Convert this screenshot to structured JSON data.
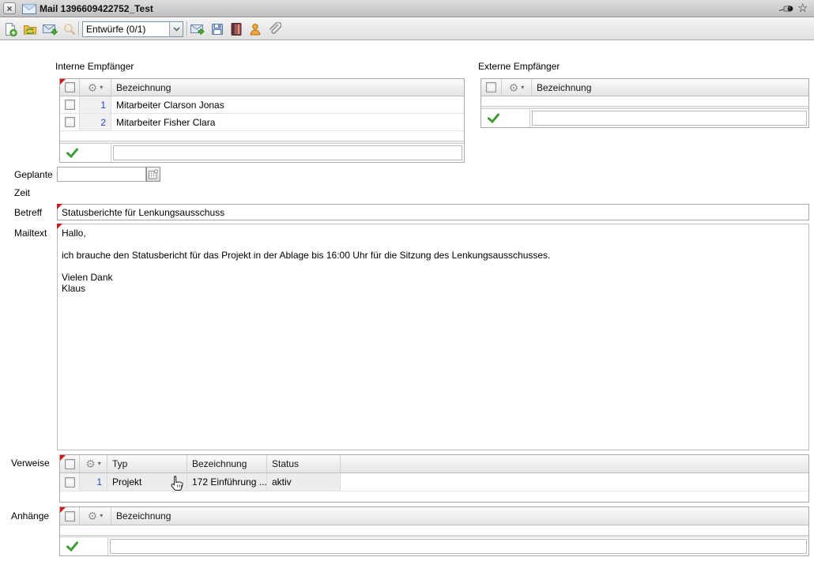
{
  "window": {
    "title": "Mail 1396609422752_Test"
  },
  "icons": {
    "close": "×",
    "gear": "⚙",
    "dropdown_arrow": "▾",
    "star": "☆"
  },
  "toolbar": {
    "folder_select": "Entwürfe (0/1)"
  },
  "sections": {
    "interne": {
      "label": "Interne Empfänger",
      "columns": {
        "bezeichnung": "Bezeichnung"
      },
      "rows": [
        {
          "num": "1",
          "name": "Mitarbeiter Clarson Jonas"
        },
        {
          "num": "2",
          "name": "Mitarbeiter Fisher Clara"
        }
      ]
    },
    "externe": {
      "label": "Externe Empfänger",
      "columns": {
        "bezeichnung": "Bezeichnung"
      }
    },
    "geplante_zeit": {
      "label_line1": "Geplante",
      "label_line2": "Zeit",
      "value": ""
    },
    "betreff": {
      "label": "Betreff",
      "value": "Statusberichte für Lenkungsausschuss"
    },
    "mailtext": {
      "label": "Mailtext",
      "value": "Hallo,\n\nich brauche den Statusbericht für das Projekt in der Ablage bis 16:00 Uhr für die Sitzung des Lenkungsausschusses.\n\nVielen Dank\nKlaus"
    },
    "verweise": {
      "label": "Verweise",
      "columns": {
        "typ": "Typ",
        "bezeichnung": "Bezeichnung",
        "status": "Status"
      },
      "rows": [
        {
          "num": "1",
          "typ": "Projekt",
          "bezeichnung": "172 Einführung ...",
          "status": "aktiv"
        }
      ]
    },
    "anhaenge": {
      "label": "Anhänge",
      "columns": {
        "bezeichnung": "Bezeichnung"
      }
    }
  },
  "colors": {
    "accent_green": "#3f9c36",
    "row_number_blue": "#2244cc",
    "required_marker_red": "#cf1a1a",
    "folder_orange": "#f3c04b",
    "person_orange": "#f0a73e"
  }
}
